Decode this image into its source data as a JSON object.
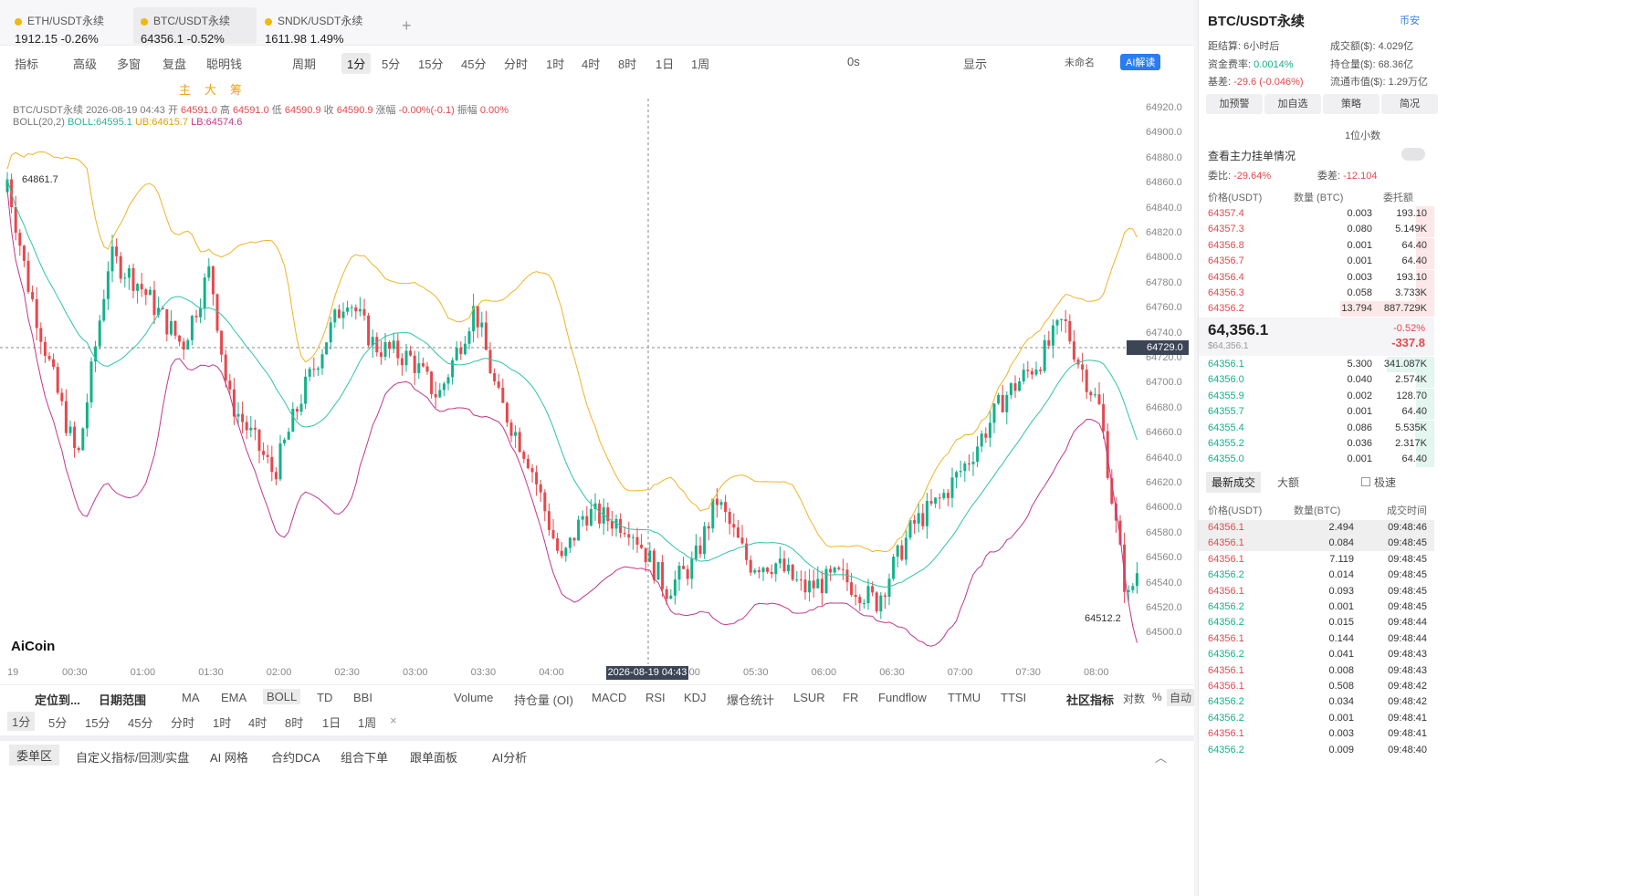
{
  "tabs": [
    {
      "name": "ETH/USDT永续",
      "price": "1912.15",
      "chg": "-0.26%"
    },
    {
      "name": "BTC/USDT永续",
      "price": "64356.1",
      "chg": "-0.52%"
    },
    {
      "name": "SNDK/USDT永续",
      "price": "1611.98",
      "chg": "1.49%"
    }
  ],
  "toolbar": {
    "items": [
      "指标",
      "高级",
      "多窗",
      "复盘",
      "聪明钱",
      "周期",
      "1分",
      "5分",
      "15分",
      "45分",
      "分时",
      "1时",
      "4时",
      "8时",
      "1日",
      "1周"
    ],
    "right": [
      "0s",
      "显示",
      "未命名",
      "AI解读"
    ]
  },
  "drawtools": [
    "主",
    "大",
    "筹"
  ],
  "info": {
    "symbol": "BTC/USDT永续",
    "time": "2026-08-19 04:43",
    "open_l": "开",
    "open": "64591.0",
    "high_l": "高",
    "high": "64591.0",
    "low_l": "低",
    "low": "64590.9",
    "close_l": "收",
    "close": "64590.9",
    "amp_l": "涨幅",
    "amp": "-0.00%(-0.1)",
    "vib_l": "振幅",
    "vib": "0.00%"
  },
  "boll": {
    "label": "BOLL(20,2)",
    "boll": "BOLL:64595.1",
    "ub": "UB:64615.7",
    "lb": "LB:64574.6"
  },
  "yaxis": [
    "64920.0",
    "64900.0",
    "64880.0",
    "64860.0",
    "64840.0",
    "64820.0",
    "64800.0",
    "64780.0",
    "64760.0",
    "64740.0",
    "64720.0",
    "64700.0",
    "64680.0",
    "64660.0",
    "64640.0",
    "64620.0",
    "64600.0",
    "64580.0",
    "64560.0",
    "64540.0",
    "64520.0",
    "64500.0"
  ],
  "crosshair_price": "64729.0",
  "crosshair_time": "2026-08-19 04:43",
  "high_mark": "64861.7",
  "low_mark": "64512.2",
  "xaxis": [
    "19",
    "00:30",
    "01:00",
    "01:30",
    "02:00",
    "02:30",
    "03:00",
    "03:30",
    "04:00",
    "04:30",
    "05:00",
    "05:30",
    "06:00",
    "06:30",
    "07:00",
    "07:30",
    "08:00"
  ],
  "logo": "AiCoin",
  "bottom_indicators": [
    "定位到...",
    "日期范围",
    "MA",
    "EMA",
    "BOLL",
    "TD",
    "BBI",
    "Volume",
    "持仓量 (OI)",
    "MACD",
    "RSI",
    "KDJ",
    "爆仓统计",
    "LSUR",
    "FR",
    "Fundflow",
    "TTMU",
    "TTSI",
    "社区指标",
    "对数",
    "%",
    "自动"
  ],
  "bottom_periods": [
    "1分",
    "5分",
    "15分",
    "45分",
    "分时",
    "1时",
    "4时",
    "8时",
    "1日",
    "1周"
  ],
  "bottom_tabs": [
    "委单区",
    "自定义指标/回测/实盘",
    "AI 网格",
    "合约DCA",
    "组合下单",
    "跟单面板",
    "AI分析"
  ],
  "right": {
    "title": "BTC/USDT永续",
    "exchange": "币安",
    "stats": [
      [
        "距结算:",
        "6小时后"
      ],
      [
        "成交额($):",
        "4.029亿"
      ],
      [
        "资金费率:",
        "0.0014%"
      ],
      [
        "持仓量($):",
        "68.36亿"
      ],
      [
        "基差:",
        "-29.6 (-0.046%)"
      ],
      [
        "流通市值($):",
        "1.29万亿"
      ]
    ],
    "buttons": [
      "加预警",
      "加自选",
      "策略",
      "简况"
    ],
    "decimal": "1位小数",
    "watch": "查看主力挂单情况",
    "ratio_l": "委比:",
    "ratio": "-29.64%",
    "diff_l": "委差:",
    "diff": "-12.104",
    "ob_headers": [
      "价格(USDT)",
      "数量 (BTC)",
      "委托额"
    ],
    "asks": [
      [
        "64357.4",
        "0.003",
        "193.10"
      ],
      [
        "64357.3",
        "0.080",
        "5.149K"
      ],
      [
        "64356.8",
        "0.001",
        "64.40"
      ],
      [
        "64356.7",
        "0.001",
        "64.40"
      ],
      [
        "64356.4",
        "0.003",
        "193.10"
      ],
      [
        "64356.3",
        "0.058",
        "3.733K"
      ],
      [
        "64356.2",
        "13.794",
        "887.729K"
      ]
    ],
    "last": "64,356.1",
    "last_usd": "$64,356.1",
    "last_pct": "-0.52%",
    "last_chg": "-337.8",
    "bids": [
      [
        "64356.1",
        "5.300",
        "341.087K"
      ],
      [
        "64356.0",
        "0.040",
        "2.574K"
      ],
      [
        "64355.9",
        "0.002",
        "128.70"
      ],
      [
        "64355.7",
        "0.001",
        "64.40"
      ],
      [
        "64355.4",
        "0.086",
        "5.535K"
      ],
      [
        "64355.2",
        "0.036",
        "2.317K"
      ],
      [
        "64355.0",
        "0.001",
        "64.40"
      ]
    ],
    "trade_tabs": [
      "最新成交",
      "大额",
      "极速"
    ],
    "tr_headers": [
      "价格(USDT)",
      "数量(BTC)",
      "成交时间"
    ],
    "trades": [
      [
        "64356.1",
        "2.494",
        "09:48:46",
        "s"
      ],
      [
        "64356.1",
        "0.084",
        "09:48:45",
        "s"
      ],
      [
        "64356.1",
        "7.119",
        "09:48:45",
        "s"
      ],
      [
        "64356.2",
        "0.014",
        "09:48:45",
        "b"
      ],
      [
        "64356.1",
        "0.093",
        "09:48:45",
        "s"
      ],
      [
        "64356.2",
        "0.001",
        "09:48:45",
        "b"
      ],
      [
        "64356.2",
        "0.015",
        "09:48:44",
        "b"
      ],
      [
        "64356.1",
        "0.144",
        "09:48:44",
        "s"
      ],
      [
        "64356.2",
        "0.041",
        "09:48:43",
        "b"
      ],
      [
        "64356.1",
        "0.008",
        "09:48:43",
        "s"
      ],
      [
        "64356.1",
        "0.508",
        "09:48:42",
        "s"
      ],
      [
        "64356.2",
        "0.034",
        "09:48:42",
        "b"
      ],
      [
        "64356.2",
        "0.001",
        "09:48:41",
        "b"
      ],
      [
        "64356.1",
        "0.003",
        "09:48:41",
        "s"
      ],
      [
        "64356.2",
        "0.009",
        "09:48:40",
        "b"
      ]
    ]
  },
  "chart_data": {
    "type": "candlestick",
    "ylim": [
      64500,
      64920
    ],
    "indicator": "BOLL(20,2)",
    "colors": {
      "up": "#13b18a",
      "down": "#e5484d",
      "ub": "#f0b429",
      "mid": "#2fc4a6",
      "lb": "#c0398b"
    }
  }
}
